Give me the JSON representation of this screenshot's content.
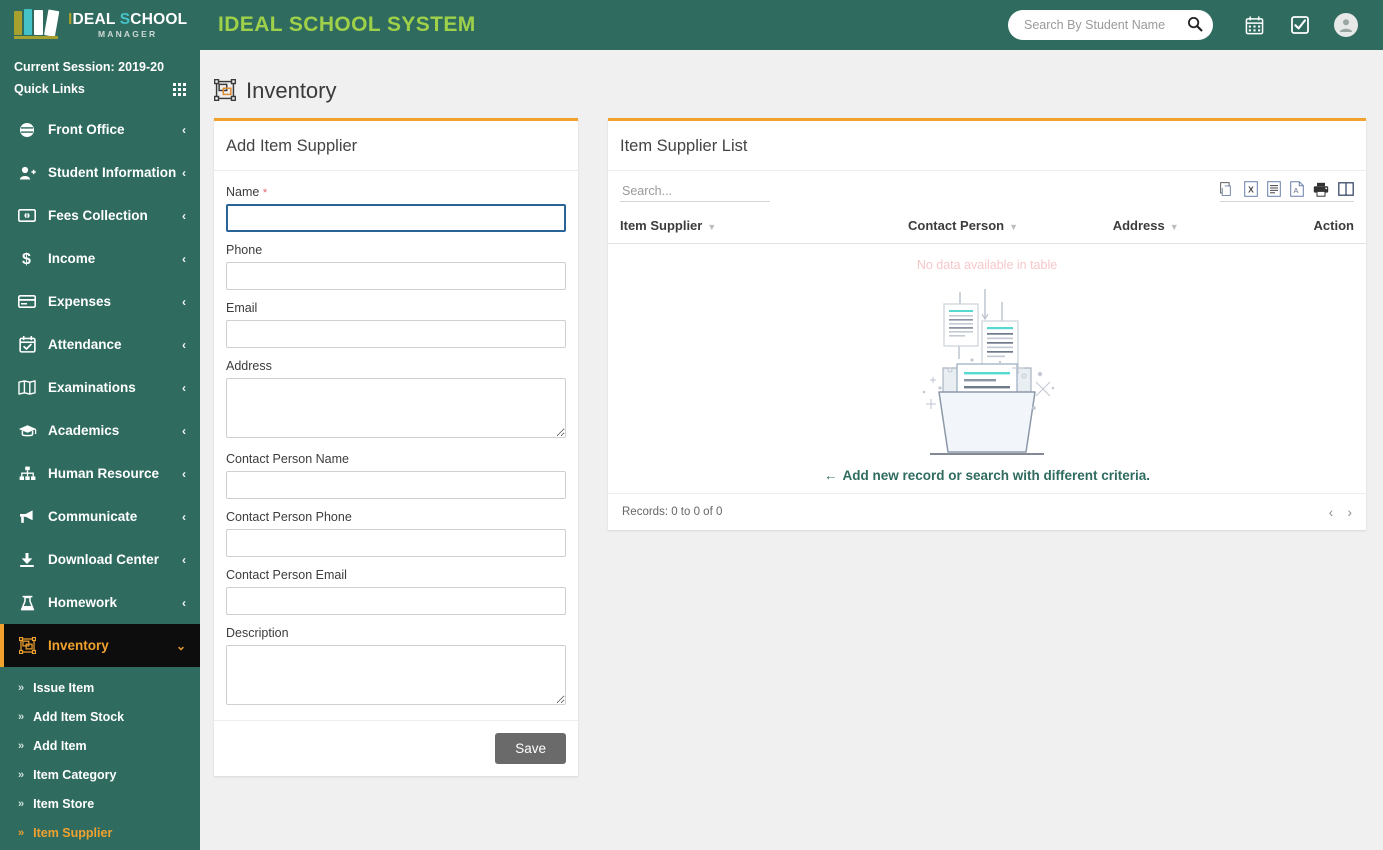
{
  "header": {
    "brand_i": "I",
    "brand_deal": "DEAL ",
    "brand_s": "S",
    "brand_chool": "CHOOL",
    "brand_sub": "MANAGER",
    "app_title": "IDEAL SCHOOL SYSTEM",
    "search_placeholder": "Search By Student Name",
    "search_value": "",
    "icons": [
      "search-icon",
      "calendar-icon",
      "checkbox-icon",
      "avatar"
    ]
  },
  "sidebar": {
    "session": "Current Session: 2019-20",
    "quick_links": "Quick Links",
    "items": [
      {
        "label": "Front Office",
        "icon": "front-office-icon",
        "chevron": "‹"
      },
      {
        "label": "Student Information",
        "icon": "user-plus-icon",
        "chevron": "‹"
      },
      {
        "label": "Fees Collection",
        "icon": "money-icon",
        "chevron": "‹"
      },
      {
        "label": "Income",
        "icon": "dollar-icon",
        "chevron": "‹"
      },
      {
        "label": "Expenses",
        "icon": "card-icon",
        "chevron": "‹"
      },
      {
        "label": "Attendance",
        "icon": "calendar-check-icon",
        "chevron": "‹"
      },
      {
        "label": "Examinations",
        "icon": "book-open-icon",
        "chevron": "‹"
      },
      {
        "label": "Academics",
        "icon": "graduation-cap-icon",
        "chevron": "‹"
      },
      {
        "label": "Human Resource",
        "icon": "sitemap-icon",
        "chevron": "‹"
      },
      {
        "label": "Communicate",
        "icon": "megaphone-icon",
        "chevron": "‹"
      },
      {
        "label": "Download Center",
        "icon": "download-icon",
        "chevron": "‹"
      },
      {
        "label": "Homework",
        "icon": "flask-icon",
        "chevron": "‹"
      },
      {
        "label": "Inventory",
        "icon": "inventory-icon",
        "chevron": "⌄",
        "active": true
      }
    ],
    "submenu": [
      {
        "label": "Issue Item"
      },
      {
        "label": "Add Item Stock"
      },
      {
        "label": "Add Item"
      },
      {
        "label": "Item Category"
      },
      {
        "label": "Item Store"
      },
      {
        "label": "Item Supplier",
        "active": true
      }
    ]
  },
  "page": {
    "title": "Inventory",
    "title_icon": "inventory-icon"
  },
  "form": {
    "title": "Add Item Supplier",
    "fields": [
      {
        "label": "Name",
        "required": true,
        "value": "",
        "type": "text",
        "focused": true,
        "name": "name-field"
      },
      {
        "label": "Phone",
        "required": false,
        "value": "",
        "type": "text",
        "name": "phone-field"
      },
      {
        "label": "Email",
        "required": false,
        "value": "",
        "type": "text",
        "name": "email-field"
      },
      {
        "label": "Address",
        "required": false,
        "value": "",
        "type": "textarea",
        "name": "address-field"
      },
      {
        "label": "Contact Person Name",
        "required": false,
        "value": "",
        "type": "text",
        "name": "contact-person-name-field"
      },
      {
        "label": "Contact Person Phone",
        "required": false,
        "value": "",
        "type": "text",
        "name": "contact-person-phone-field"
      },
      {
        "label": "Contact Person Email",
        "required": false,
        "value": "",
        "type": "text",
        "name": "contact-person-email-field"
      },
      {
        "label": "Description",
        "required": false,
        "value": "",
        "type": "textarea",
        "name": "description-field"
      }
    ],
    "save_label": "Save"
  },
  "list": {
    "title": "Item Supplier List",
    "search_placeholder": "Search...",
    "search_value": "",
    "tools": [
      {
        "name": "copy-icon",
        "title": "Copy"
      },
      {
        "name": "excel-icon",
        "title": "Excel"
      },
      {
        "name": "csv-icon",
        "title": "CSV"
      },
      {
        "name": "pdf-icon",
        "title": "PDF"
      },
      {
        "name": "print-icon",
        "title": "Print"
      },
      {
        "name": "columns-icon",
        "title": "Column visibility"
      }
    ],
    "columns": [
      {
        "label": "Item Supplier",
        "sortable": true
      },
      {
        "label": "Contact Person",
        "sortable": true
      },
      {
        "label": "Address",
        "sortable": true
      },
      {
        "label": "Action",
        "sortable": false
      }
    ],
    "no_data": "No data available in table",
    "empty_arrow": "←",
    "empty_message": "Add new record or search with different criteria.",
    "records": "Records: 0 to 0 of 0",
    "prev": "‹",
    "next": "›"
  },
  "colors": {
    "brand_green": "#2f6b5f",
    "accent_orange": "#f0a12e",
    "app_title_green": "#9fd04a",
    "active_bg": "#0d0d0d",
    "page_bg": "#f0f0f0",
    "save_gray": "#6a6a6a",
    "no_data_pink": "#f7c7ca"
  }
}
